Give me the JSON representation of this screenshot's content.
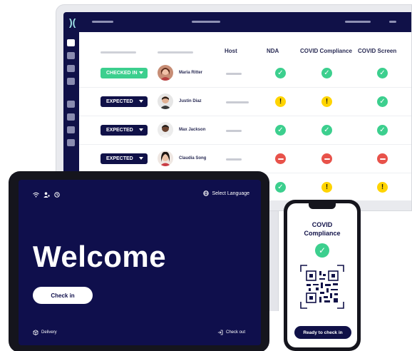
{
  "monitor": {
    "columns": {
      "host": "Host",
      "nda": "NDA",
      "covid_compliance": "COVID Compliance",
      "covid_screen": "COVID Screen"
    },
    "visitors": [
      {
        "status": "CHECKED IN",
        "name": "Maria Ritter",
        "nda": "ok",
        "compliance": "ok",
        "screen": "ok"
      },
      {
        "status": "EXPECTED",
        "name": "Justin Diaz",
        "nda": "warn",
        "compliance": "warn",
        "screen": "ok"
      },
      {
        "status": "EXPECTED",
        "name": "Max Jackson",
        "nda": "ok",
        "compliance": "ok",
        "screen": "ok"
      },
      {
        "status": "EXPECTED",
        "name": "Claudia Song",
        "nda": "no",
        "compliance": "no",
        "screen": "no"
      },
      {
        "status": "",
        "name": "",
        "nda": "ok",
        "compliance": "warn",
        "screen": "warn"
      }
    ]
  },
  "tablet": {
    "select_language": "Select Language",
    "welcome": "Welcome",
    "check_in": "Check in",
    "delivery": "Delivery",
    "check_out": "Check out"
  },
  "phone": {
    "title_line1": "COVID",
    "title_line2": "Compliance",
    "ready_button": "Ready to check in"
  },
  "colors": {
    "navy": "#101148",
    "green": "#3ccf8e",
    "yellow": "#ffd400",
    "red": "#e8524a"
  }
}
